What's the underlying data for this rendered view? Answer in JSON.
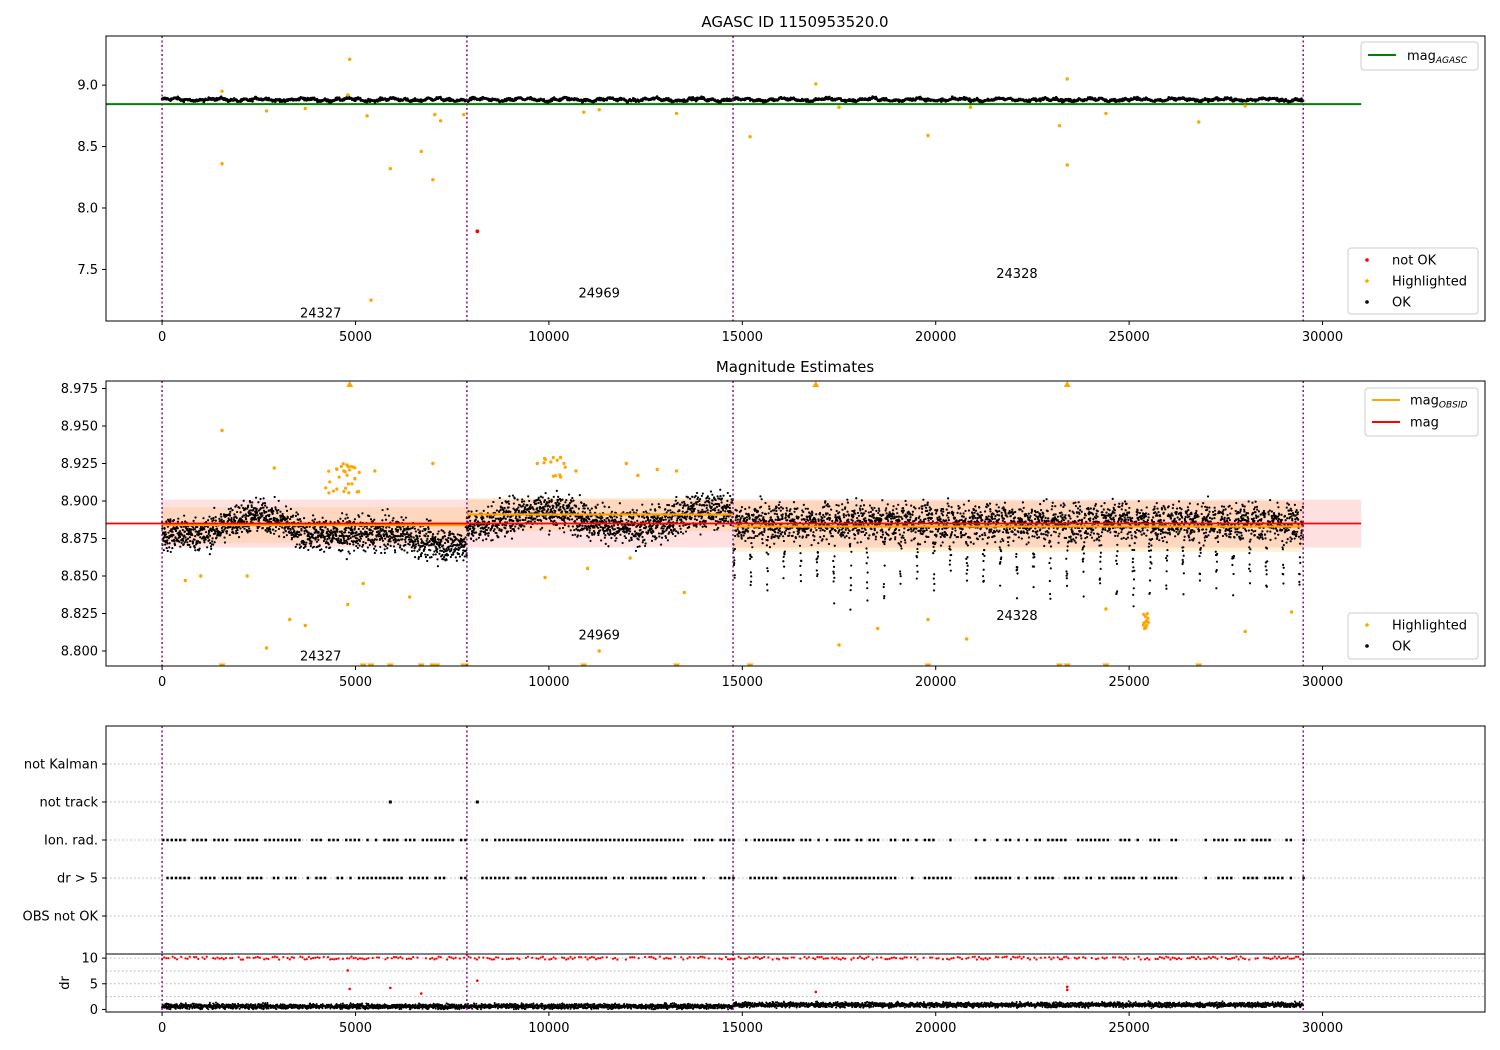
{
  "chart_data": [
    {
      "type": "scatter",
      "title": "AGASC ID 1150953520.0",
      "xlim": [
        -1450,
        34200
      ],
      "ylim": [
        7.08,
        9.4
      ],
      "xticks": [
        0,
        5000,
        10000,
        15000,
        20000,
        25000,
        30000
      ],
      "yticks": [
        7.5,
        8.0,
        8.5,
        9.0
      ],
      "ytick_labels": [
        "7.5",
        "8.0",
        "8.5",
        "9.0"
      ],
      "obsid_boundaries": [
        0,
        7880,
        14760,
        29500
      ],
      "obsid_labels": [
        {
          "text": "24327",
          "x": 4100,
          "y": 7.15
        },
        {
          "text": "24969",
          "x": 11300,
          "y": 7.31
        },
        {
          "text": "24328",
          "x": 22100,
          "y": 7.47
        }
      ],
      "lines": [
        {
          "name": "mag_AGASC",
          "color": "#008000",
          "x": [
            -1450,
            31000
          ],
          "y": [
            8.845,
            8.845
          ]
        }
      ],
      "series": [
        {
          "name": "not OK",
          "color": "#ff0000",
          "points": [
            [
              8150,
              7.81
            ]
          ]
        },
        {
          "name": "Highlighted",
          "color": "#ffa500",
          "points": [
            [
              1550,
              8.95
            ],
            [
              1550,
              8.36
            ],
            [
              2700,
              8.79
            ],
            [
              3700,
              8.81
            ],
            [
              4800,
              8.92
            ],
            [
              4850,
              9.21
            ],
            [
              5300,
              8.75
            ],
            [
              5400,
              7.25
            ],
            [
              5900,
              8.32
            ],
            [
              6700,
              8.46
            ],
            [
              7000,
              8.23
            ],
            [
              7050,
              8.76
            ],
            [
              7200,
              8.71
            ],
            [
              7800,
              8.76
            ],
            [
              10900,
              8.78
            ],
            [
              11300,
              8.8
            ],
            [
              13300,
              8.77
            ],
            [
              15200,
              8.58
            ],
            [
              16900,
              9.01
            ],
            [
              17500,
              8.82
            ],
            [
              19800,
              8.59
            ],
            [
              20900,
              8.82
            ],
            [
              23200,
              8.67
            ],
            [
              23400,
              9.05
            ],
            [
              23400,
              8.35
            ],
            [
              24400,
              8.77
            ],
            [
              26800,
              8.7
            ],
            [
              28000,
              8.83
            ]
          ]
        },
        {
          "name": "OK",
          "color": "#000000",
          "generated": "band",
          "center": 8.882,
          "spread": 0.03
        }
      ],
      "legend_lines": [
        {
          "label": "mag",
          "sub": "AGASC",
          "color": "#008000"
        }
      ],
      "legend_points": [
        {
          "label": "not OK",
          "color": "#ff0000"
        },
        {
          "label": "Highlighted",
          "color": "#ffa500"
        },
        {
          "label": "OK",
          "color": "#000000"
        }
      ]
    },
    {
      "type": "scatter",
      "title": "Magnitude Estimates",
      "xlim": [
        -1450,
        34200
      ],
      "ylim": [
        8.79,
        8.98
      ],
      "xticks": [
        0,
        5000,
        10000,
        15000,
        20000,
        25000,
        30000
      ],
      "yticks": [
        8.8,
        8.825,
        8.85,
        8.875,
        8.9,
        8.925,
        8.95,
        8.975
      ],
      "ytick_labels": [
        "8.800",
        "8.825",
        "8.850",
        "8.875",
        "8.900",
        "8.925",
        "8.950",
        "8.975"
      ],
      "obsid_boundaries": [
        0,
        7880,
        14760,
        29500
      ],
      "obsid_labels": [
        {
          "text": "24327",
          "x": 4100,
          "y": 8.797
        },
        {
          "text": "24969",
          "x": 11300,
          "y": 8.811
        },
        {
          "text": "24328",
          "x": 22100,
          "y": 8.824
        }
      ],
      "mag": 8.885,
      "mag_band": [
        8.869,
        8.901
      ],
      "mag_obsid": [
        {
          "x": [
            0,
            7880
          ],
          "y": 8.884,
          "band": [
            8.872,
            8.896
          ]
        },
        {
          "x": [
            7880,
            14760
          ],
          "y": 8.891,
          "band": [
            8.88,
            8.902
          ]
        },
        {
          "x": [
            14760,
            29500
          ],
          "y": 8.883,
          "band": [
            8.866,
            8.9
          ]
        }
      ],
      "series": [
        {
          "name": "Highlighted",
          "color": "#ffa500",
          "points": [
            [
              1550,
              8.947
            ],
            [
              1000,
              8.85
            ],
            [
              600,
              8.847
            ],
            [
              2200,
              8.85
            ],
            [
              2700,
              8.802
            ],
            [
              2900,
              8.922
            ],
            [
              3300,
              8.821
            ],
            [
              3700,
              8.817
            ],
            [
              4700,
              8.92
            ],
            [
              4800,
              8.831
            ],
            [
              5200,
              8.845
            ],
            [
              5500,
              8.92
            ],
            [
              6400,
              8.836
            ],
            [
              7000,
              8.925
            ],
            [
              9700,
              8.925
            ],
            [
              9900,
              8.849
            ],
            [
              10300,
              8.929
            ],
            [
              10700,
              8.92
            ],
            [
              11000,
              8.855
            ],
            [
              11300,
              8.8
            ],
            [
              12000,
              8.925
            ],
            [
              12100,
              8.862
            ],
            [
              12300,
              8.917
            ],
            [
              12800,
              8.921
            ],
            [
              13300,
              8.92
            ],
            [
              13500,
              8.839
            ],
            [
              17500,
              8.804
            ],
            [
              18500,
              8.815
            ],
            [
              19800,
              8.821
            ],
            [
              20800,
              8.808
            ],
            [
              24400,
              8.828
            ],
            [
              25400,
              8.815
            ],
            [
              28000,
              8.813
            ],
            [
              29200,
              8.826
            ]
          ]
        },
        {
          "name": "OK",
          "color": "#000000",
          "generated": "noisy"
        }
      ],
      "clipped_low_x": [
        1550,
        5200,
        5400,
        5900,
        6700,
        7000,
        7100,
        7800,
        7850,
        10900,
        13300,
        15200,
        19800,
        23200,
        23400,
        24400,
        26800
      ],
      "clipped_high_x": [
        4850,
        16900,
        23400
      ],
      "legend_lines": [
        {
          "label": "mag",
          "sub": "OBSID",
          "color": "#ffa500"
        },
        {
          "label": "mag",
          "sub": "",
          "color": "#ff0000"
        }
      ],
      "legend_points": [
        {
          "label": "Highlighted",
          "color": "#ffa500"
        },
        {
          "label": "OK",
          "color": "#000000"
        }
      ]
    },
    {
      "type": "scatter",
      "title": "",
      "xlim": [
        -1450,
        34200
      ],
      "categories": [
        "OBS not OK",
        "dr > 5",
        "Ion. rad.",
        "not track",
        "not Kalman"
      ],
      "not_track_points": [
        5900,
        8150
      ],
      "flag_gaps": [
        [
          7880,
          8200
        ],
        [
          14760,
          14900
        ],
        [
          20400,
          21000
        ],
        [
          26200,
          26900
        ]
      ]
    },
    {
      "type": "scatter",
      "title": "",
      "xlim": [
        -1450,
        34200
      ],
      "ylim": [
        -0.5,
        10.8
      ],
      "yticks": [
        0,
        5,
        10
      ],
      "ylabel": "dr",
      "series": [
        {
          "name": "dr > 5",
          "color": "#ff0000",
          "points": [
            [
              4800,
              7.6
            ],
            [
              4850,
              4.0
            ],
            [
              5900,
              4.2
            ],
            [
              6700,
              3.1
            ],
            [
              8150,
              5.6
            ],
            [
              16900,
              3.4
            ],
            [
              23400,
              3.8
            ],
            [
              23400,
              4.4
            ]
          ]
        },
        {
          "name": "dr",
          "color": "#000000",
          "generated": "low"
        }
      ]
    }
  ]
}
